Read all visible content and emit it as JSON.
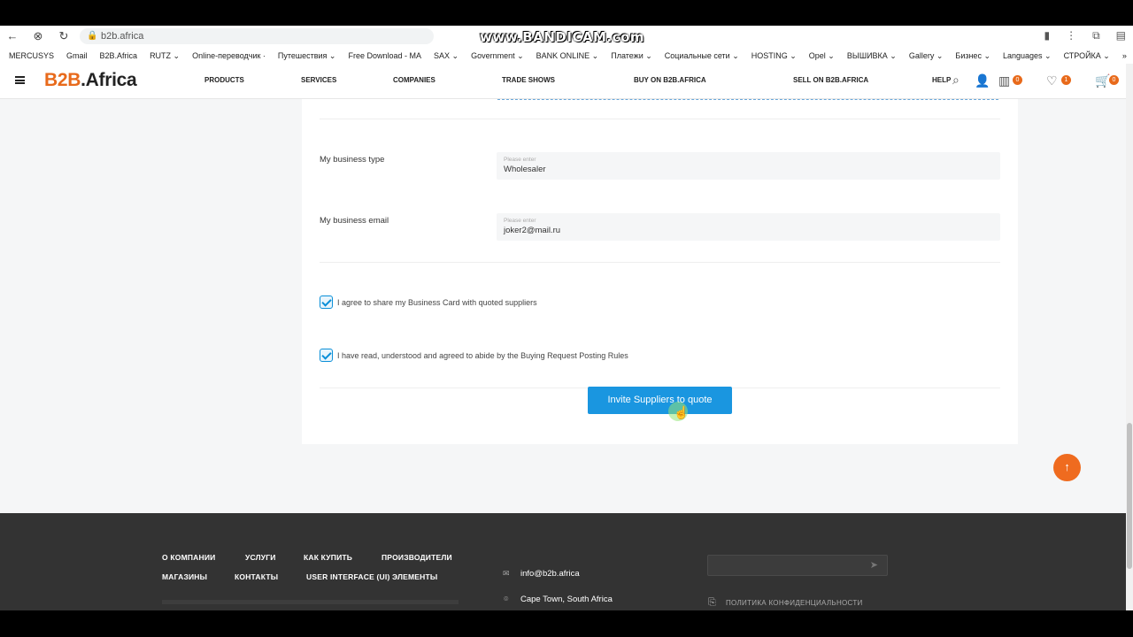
{
  "browser": {
    "url": "b2b.africa",
    "watermark": "www.BANDICAM.com",
    "bookmarks": [
      "MERCUSYS",
      "Gmail",
      "B2B.Africa",
      "RUTZ ⌄",
      "Online-переводчик ·",
      "Путешествия ⌄",
      "Free Download - MA",
      "SAX ⌄",
      "Government ⌄",
      "BANK ONLINE ⌄",
      "Платежи ⌄",
      "Социальные сети ⌄",
      "HOSTING ⌄",
      "Opel ⌄",
      "ВЫШИВКА ⌄",
      "Gallery ⌄",
      "Бизнес ⌄",
      "Languages ⌄",
      "СТРОЙКА ⌄",
      "»"
    ]
  },
  "header": {
    "logo_prefix": "B2B",
    "logo_suffix": ".Africa",
    "menu": [
      "PRODUCTS",
      "SERVICES",
      "COMPANIES",
      "TRADE SHOWS",
      "BUY ON B2B.AFRICA",
      "SELL ON B2B.AFRICA"
    ],
    "help": "HELP",
    "compare_count": "0",
    "wishlist_count": "1",
    "cart_count": "0"
  },
  "form": {
    "business_type_label": "My business type",
    "business_type_placeholder": "Please enter",
    "business_type_value": "Wholesaler",
    "business_email_label": "My business email",
    "business_email_placeholder": "Please enter",
    "business_email_value": "joker2@mail.ru",
    "agree_card_text": "I agree to share my Business Card with quoted suppliers",
    "agree_rules_text": "I have read, understood and agreed to abide by the Buying Request Posting Rules",
    "submit_label": "Invite Suppliers to quote"
  },
  "footer": {
    "links_row1": [
      "О КОМПАНИИ",
      "УСЛУГИ",
      "КАК КУПИТЬ",
      "ПРОИЗВОДИТЕЛИ"
    ],
    "links_row2": [
      "МАГАЗИНЫ",
      "КОНТАКТЫ",
      "USER INTERFACE (UI) ЭЛЕМЕНТЫ"
    ],
    "email": "info@b2b.africa",
    "address": "Cape Town, South Africa",
    "policy": "ПОЛИТИКА КОНФИДЕНЦИАЛЬНОСТИ"
  },
  "colors": {
    "accent_orange": "#e86a1b",
    "button_blue": "#1a96e0",
    "footer_bg": "#333333"
  }
}
